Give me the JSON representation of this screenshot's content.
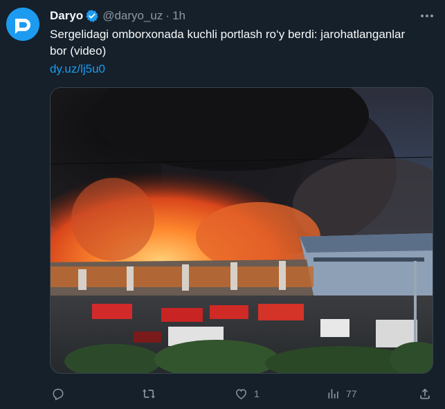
{
  "author": {
    "display_name": "Daryo",
    "handle": "@daryo_uz",
    "separator": "·",
    "time": "1h",
    "avatar_icon": "daryo-logo-icon",
    "verified_icon": "verified-badge-icon"
  },
  "tweet": {
    "text": "Sergelidagi omborxonada kuchli portlash ro‘y berdi: jarohatlanganlar bor (video)",
    "link": "dy.uz/lj5u0",
    "media_icon": "warehouse-fire-photo"
  },
  "actions": {
    "reply": {
      "icon": "reply-icon",
      "count": ""
    },
    "retweet": {
      "icon": "retweet-icon",
      "count": ""
    },
    "like": {
      "icon": "heart-icon",
      "count": "1"
    },
    "views": {
      "icon": "views-icon",
      "count": "77"
    },
    "share": {
      "icon": "share-icon"
    }
  },
  "colors": {
    "background": "#15202b",
    "accent": "#1d9bf0",
    "secondary_text": "#8b98a5"
  }
}
